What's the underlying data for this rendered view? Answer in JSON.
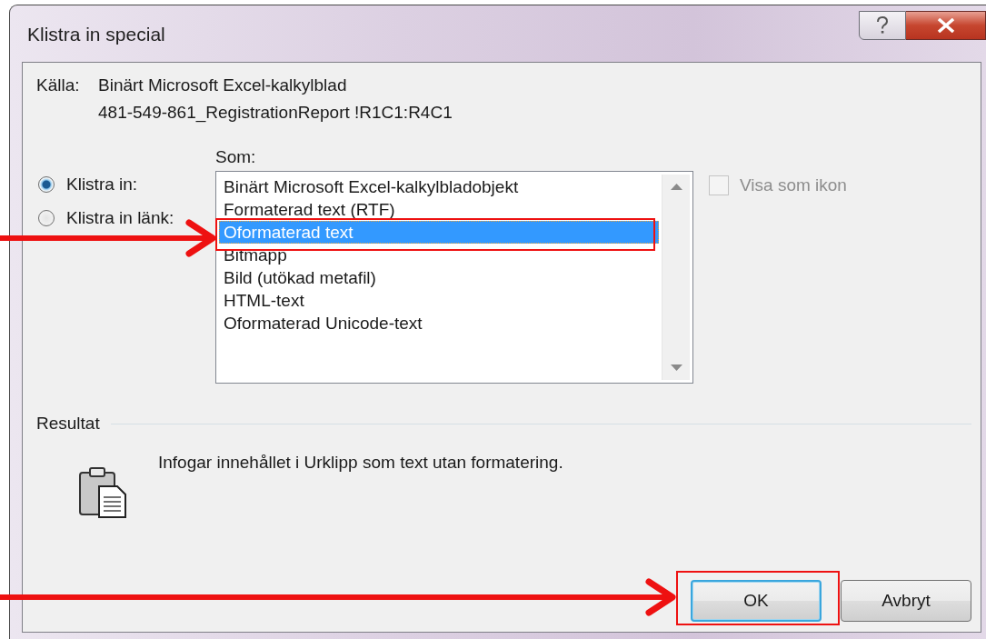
{
  "window": {
    "title": "Klistra in special"
  },
  "source": {
    "label": "Källa:",
    "lines": [
      "Binärt Microsoft Excel-kalkylblad",
      "481-549-861_RegistrationReport !R1C1:R4C1"
    ]
  },
  "paste_options": [
    {
      "label": "Klistra in:",
      "selected": true
    },
    {
      "label": "Klistra in länk:",
      "selected": false
    }
  ],
  "as_label": "Som:",
  "formats": [
    {
      "label": "Binärt Microsoft Excel-kalkylbladobjekt",
      "selected": false
    },
    {
      "label": "Formaterad text (RTF)",
      "selected": false
    },
    {
      "label": "Oformaterad text",
      "selected": true
    },
    {
      "label": "Bitmapp",
      "selected": false
    },
    {
      "label": "Bild (utökad metafil)",
      "selected": false
    },
    {
      "label": "HTML-text",
      "selected": false
    },
    {
      "label": "Oformaterad Unicode-text",
      "selected": false
    }
  ],
  "display_as_icon": {
    "label": "Visa som ikon",
    "checked": false,
    "disabled": true
  },
  "result": {
    "heading": "Resultat",
    "description": "Infogar innehållet i Urklipp som text utan formatering."
  },
  "buttons": [
    {
      "label": "OK",
      "kind": "default"
    },
    {
      "label": "Avbryt",
      "kind": "normal"
    }
  ]
}
